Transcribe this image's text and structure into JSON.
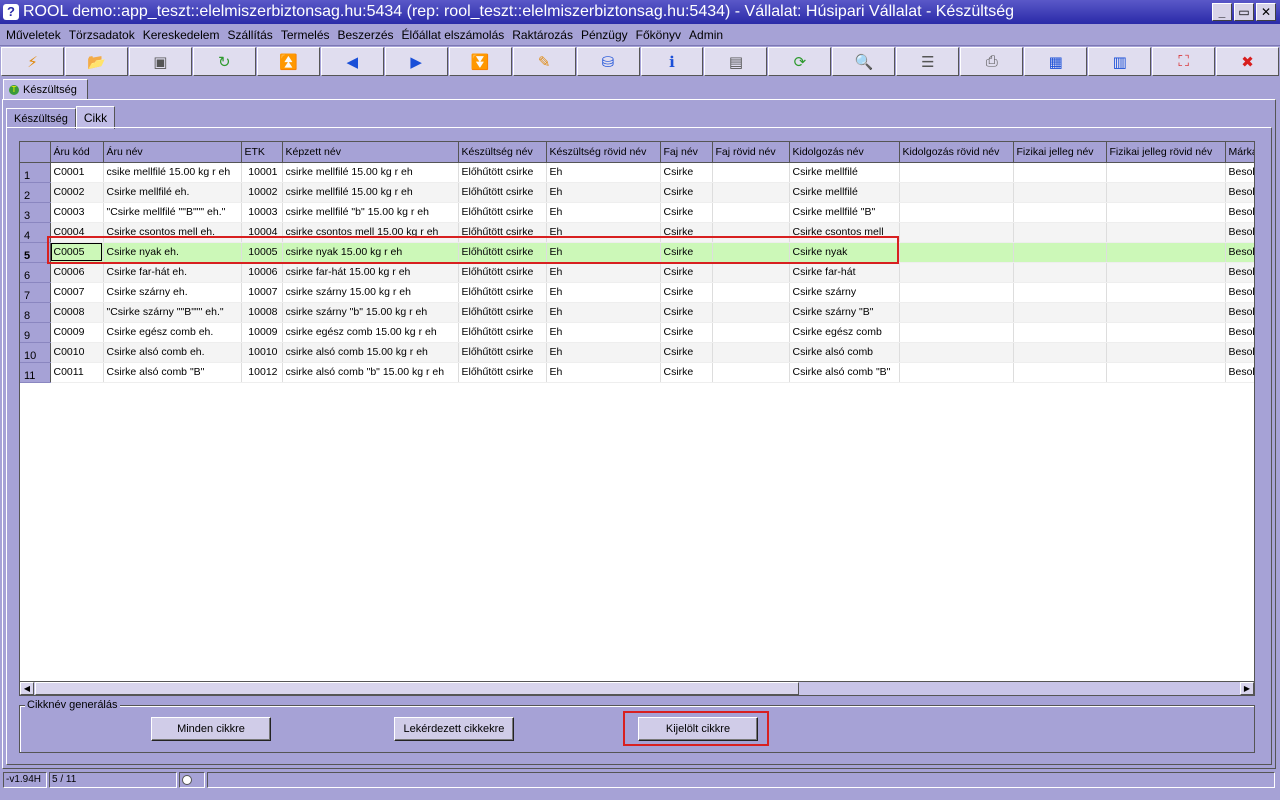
{
  "window": {
    "title": "ROOL demo::app_teszt::elelmiszerbiztonsag.hu:5434 (rep: rool_teszt::elelmiszerbiztonsag.hu:5434) - Vállalat: Húsipari Vállalat - Készültség",
    "min": "_",
    "max": "▭",
    "close": "✕"
  },
  "menu": [
    "Műveletek",
    "Törzsadatok",
    "Kereskedelem",
    "Szállítás",
    "Termelés",
    "Beszerzés",
    "Élőállat elszámolás",
    "Raktározás",
    "Pénzügy",
    "Főkönyv",
    "Admin"
  ],
  "toolbar": [
    {
      "icon": "lightning-icon",
      "glyph": "⚡",
      "color": "c-orange"
    },
    {
      "icon": "open-folder-icon",
      "glyph": "📂",
      "color": ""
    },
    {
      "icon": "save-icon",
      "glyph": "▣",
      "color": "c-gray"
    },
    {
      "icon": "refresh-green-icon",
      "glyph": "↻",
      "color": "c-green"
    },
    {
      "icon": "first-record-icon",
      "glyph": "⏫",
      "color": ""
    },
    {
      "icon": "prev-record-icon",
      "glyph": "◀",
      "color": ""
    },
    {
      "icon": "next-record-icon",
      "glyph": "▶",
      "color": ""
    },
    {
      "icon": "last-record-icon",
      "glyph": "⏬",
      "color": ""
    },
    {
      "icon": "edit-icon",
      "glyph": "✎",
      "color": "c-orange"
    },
    {
      "icon": "database-icon",
      "glyph": "⛁",
      "color": ""
    },
    {
      "icon": "info-icon",
      "glyph": "ℹ",
      "color": ""
    },
    {
      "icon": "form-view-icon",
      "glyph": "▤",
      "color": "c-gray"
    },
    {
      "icon": "reload-icon",
      "glyph": "⟳",
      "color": "c-green"
    },
    {
      "icon": "search-icon",
      "glyph": "🔍",
      "color": ""
    },
    {
      "icon": "columns-icon",
      "glyph": "☰",
      "color": "c-gray"
    },
    {
      "icon": "print-icon",
      "glyph": "⎙",
      "color": "c-gray"
    },
    {
      "icon": "grid-export-icon",
      "glyph": "▦",
      "color": ""
    },
    {
      "icon": "grid-import-icon",
      "glyph": "▥",
      "color": ""
    },
    {
      "icon": "fullscreen-icon",
      "glyph": "⛶",
      "color": "c-red"
    },
    {
      "icon": "close-red-icon",
      "glyph": "✖",
      "color": "c-red"
    }
  ],
  "doc_tab": {
    "label": "Készültség",
    "icon_glyph": "T"
  },
  "subtabs": [
    {
      "label": "Készültség",
      "active": false
    },
    {
      "label": "Cikk",
      "active": true
    }
  ],
  "grid": {
    "columns": [
      {
        "label": "",
        "w": 30
      },
      {
        "label": "Áru kód",
        "w": 53
      },
      {
        "label": "Áru név",
        "w": 138
      },
      {
        "label": "ETK",
        "w": 41
      },
      {
        "label": "Képzett név",
        "w": 176
      },
      {
        "label": "Készültség név",
        "w": 88
      },
      {
        "label": "Készültség rövid név",
        "w": 114
      },
      {
        "label": "Faj név",
        "w": 52
      },
      {
        "label": "Faj rövid név",
        "w": 77
      },
      {
        "label": "Kidolgozás név",
        "w": 110
      },
      {
        "label": "Kidolgozás rövid név",
        "w": 114
      },
      {
        "label": "Fizikai jelleg név",
        "w": 93
      },
      {
        "label": "Fizikai jelleg rövid név",
        "w": 119
      },
      {
        "label": "Márka",
        "w": 40
      }
    ],
    "rows": [
      [
        "1",
        "C0001",
        " csike mellfilé 15.00 kg r eh",
        "10001",
        "csirke mellfilé 15.00 kg r eh",
        "Előhűtött csirke",
        "Eh",
        "Csirke",
        "",
        "Csirke mellfilé",
        "",
        "",
        "",
        "Besolo"
      ],
      [
        "2",
        "C0002",
        "Csirke mellfilé eh.",
        "10002",
        "csirke mellfilé 15.00 kg r eh",
        "Előhűtött csirke",
        "Eh",
        "Csirke",
        "",
        "Csirke mellfilé",
        "",
        "",
        "",
        "Besolo"
      ],
      [
        "3",
        "C0003",
        "\"Csirke mellfilé \"\"B\"\"\" eh.\"",
        "10003",
        "csirke mellfilé \"b\" 15.00 kg r eh",
        "Előhűtött csirke",
        "Eh",
        "Csirke",
        "",
        "Csirke mellfilé \"B\"",
        "",
        "",
        "",
        "Besolo"
      ],
      [
        "4",
        "C0004",
        "Csirke csontos mell eh.",
        "10004",
        "csirke csontos mell 15.00 kg r eh",
        "Előhűtött csirke",
        "Eh",
        "Csirke",
        "",
        "Csirke csontos mell",
        "",
        "",
        "",
        "Besolo"
      ],
      [
        "5",
        "C0005",
        "Csirke nyak eh.",
        "10005",
        "csirke nyak 15.00 kg r eh",
        "Előhűtött csirke",
        "Eh",
        "Csirke",
        "",
        "Csirke nyak",
        "",
        "",
        "",
        "Besolo"
      ],
      [
        "6",
        "C0006",
        "Csirke far-hát eh.",
        "10006",
        "csirke far-hát 15.00 kg r eh",
        "Előhűtött csirke",
        "Eh",
        "Csirke",
        "",
        "Csirke far-hát",
        "",
        "",
        "",
        "Besolo"
      ],
      [
        "7",
        "C0007",
        "Csirke szárny eh.",
        "10007",
        "csirke szárny 15.00 kg r eh",
        "Előhűtött csirke",
        "Eh",
        "Csirke",
        "",
        "Csirke szárny",
        "",
        "",
        "",
        "Besolo"
      ],
      [
        "8",
        "C0008",
        "\"Csirke szárny \"\"B\"\"\" eh.\"",
        "10008",
        "csirke szárny \"b\" 15.00 kg r eh",
        "Előhűtött csirke",
        "Eh",
        "Csirke",
        "",
        "Csirke szárny \"B\"",
        "",
        "",
        "",
        "Besolo"
      ],
      [
        "9",
        "C0009",
        "Csirke egész comb eh.",
        "10009",
        "csirke egész comb 15.00 kg r eh",
        "Előhűtött csirke",
        "Eh",
        "Csirke",
        "",
        "Csirke egész comb",
        "",
        "",
        "",
        "Besolo"
      ],
      [
        "10",
        "C0010",
        "Csirke alsó comb eh.",
        "10010",
        "csirke alsó comb 15.00 kg r eh",
        "Előhűtött csirke",
        "Eh",
        "Csirke",
        "",
        "Csirke alsó comb",
        "",
        "",
        "",
        "Besolo"
      ],
      [
        "11",
        "C0011",
        "Csirke alsó comb \"B\"",
        "10012",
        "csirke alsó comb \"b\" 15.00 kg r eh",
        "Előhűtött csirke",
        "Eh",
        "Csirke",
        "",
        "Csirke alsó comb \"B\"",
        "",
        "",
        "",
        "Besolo"
      ]
    ],
    "selected_row": 4
  },
  "scroll": {
    "left": "◀",
    "right": "▶"
  },
  "group": {
    "legend": "Cikknév generálás",
    "btn_all": "Minden cikkre",
    "btn_queried": "Lekérdezett cikkekre",
    "btn_selected": "Kijelölt cikkre"
  },
  "status": {
    "version": "-v1.94H",
    "position": "5 / 11"
  }
}
